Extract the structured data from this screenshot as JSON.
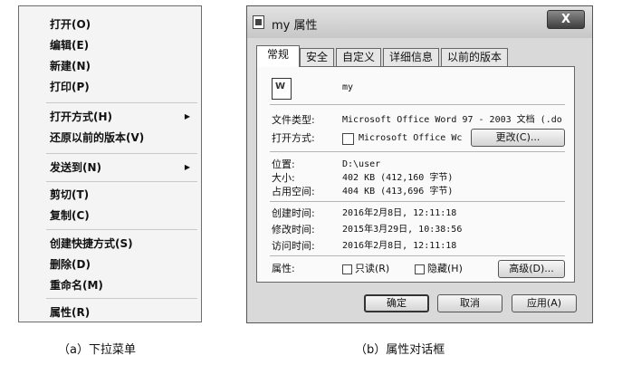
{
  "menu": {
    "items": [
      {
        "label": "打开(O)",
        "arrow": false
      },
      {
        "label": "编辑(E)",
        "arrow": false
      },
      {
        "label": "新建(N)",
        "arrow": false
      },
      {
        "label": "打印(P)",
        "arrow": false
      },
      {
        "label": "打开方式(H)",
        "arrow": true
      },
      {
        "label": "还原以前的版本(V)",
        "arrow": false
      },
      {
        "label": "发送到(N)",
        "arrow": true
      },
      {
        "label": "剪切(T)",
        "arrow": false
      },
      {
        "label": "复制(C)",
        "arrow": false
      },
      {
        "label": "创建快捷方式(S)",
        "arrow": false
      },
      {
        "label": "删除(D)",
        "arrow": false
      },
      {
        "label": "重命名(M)",
        "arrow": false
      },
      {
        "label": "属性(R)",
        "arrow": false
      }
    ],
    "submenu_arrow": "▶"
  },
  "dialog": {
    "title": "my 属性",
    "close_label": "X",
    "tabs": [
      "常规",
      "安全",
      "自定义",
      "详细信息",
      "以前的版本"
    ],
    "filename": "my",
    "file_type_label": "文件类型:",
    "file_type_value": "Microsoft Office Word 97 - 2003 文档 (.do",
    "open_with_label": "打开方式:",
    "open_with_value": "Microsoft Office Wc",
    "change_button": "更改(C)...",
    "location_label": "位置:",
    "location_value": "D:\\user",
    "size_label": "大小:",
    "size_value": "402 KB (412,160 字节)",
    "disk_size_label": "占用空间:",
    "disk_size_value": "404 KB (413,696 字节)",
    "created_label": "创建时间:",
    "created_value": "2016年2月8日, 12:11:18",
    "modified_label": "修改时间:",
    "modified_value": "2015年3月29日, 10:38:56",
    "accessed_label": "访问时间:",
    "accessed_value": "2016年2月8日, 12:11:18",
    "attributes_label": "属性:",
    "readonly_label": "只读(R)",
    "hidden_label": "隐藏(H)",
    "advanced_button": "高级(D)...",
    "ok_button": "确定",
    "cancel_button": "取消",
    "apply_button": "应用(A)"
  },
  "captions": {
    "left": "（a）下拉菜单",
    "right": "（b）属性对话框"
  }
}
